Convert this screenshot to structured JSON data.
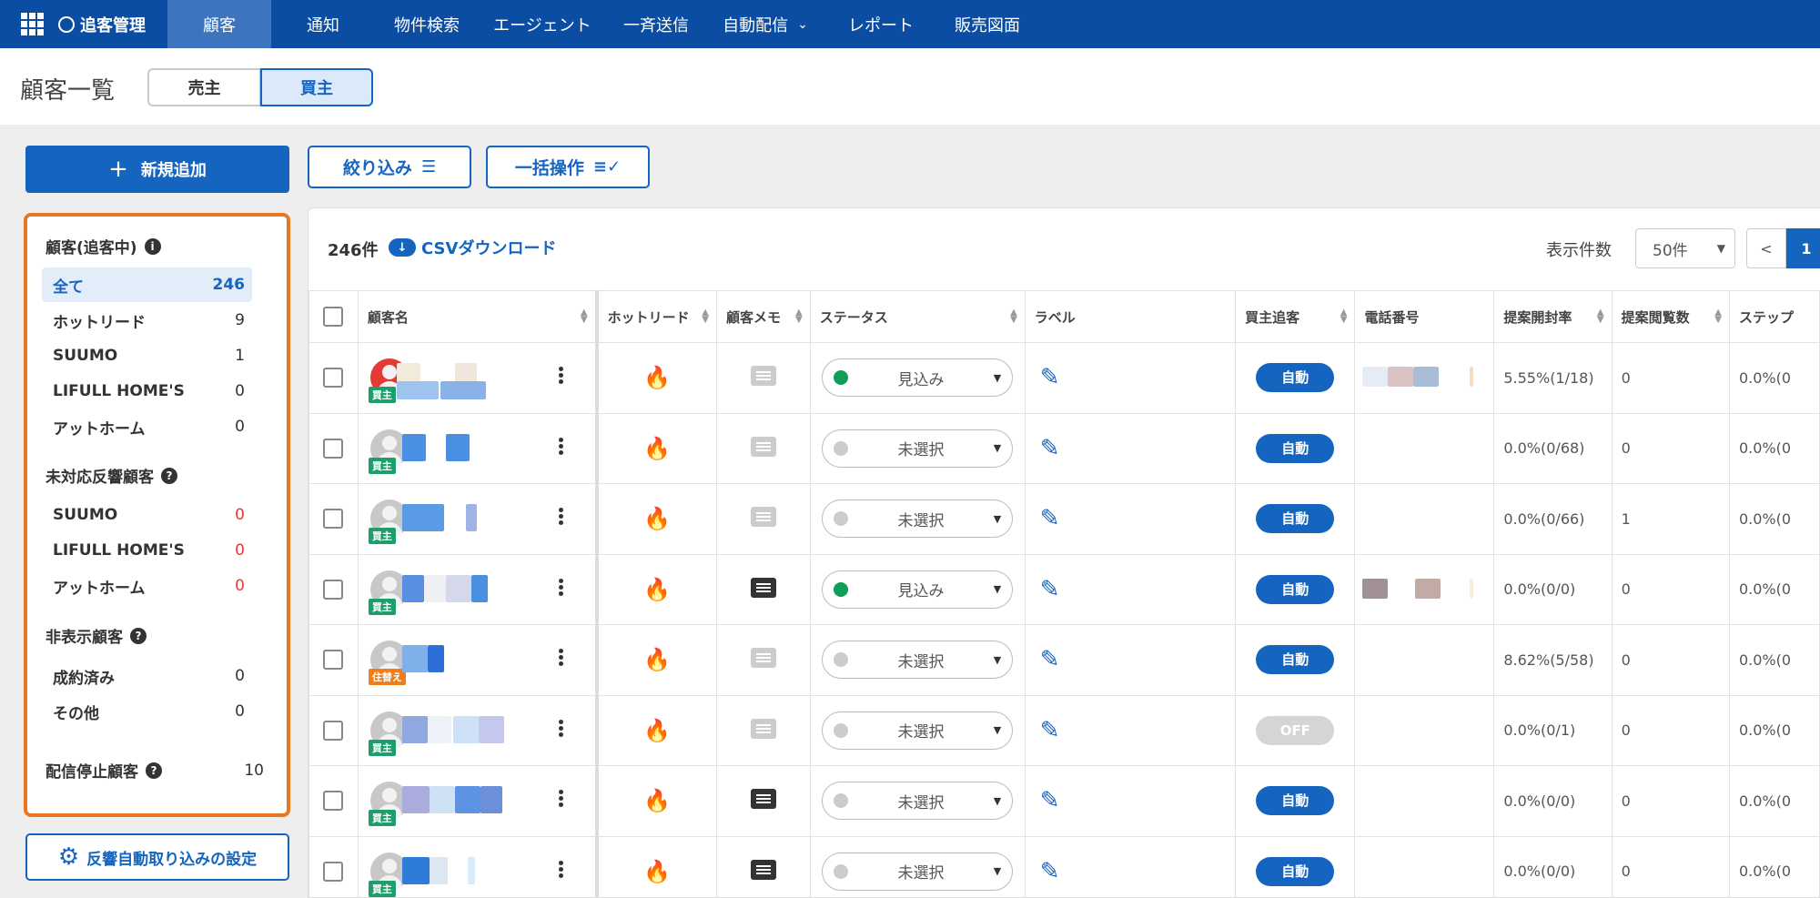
{
  "nav": {
    "brand": "追客管理",
    "items": [
      "顧客",
      "通知",
      "物件検索",
      "エージェント",
      "一斉送信",
      "自動配信",
      "レポート",
      "販売図面"
    ]
  },
  "header": {
    "title": "顧客一覧",
    "seg_sell": "売主",
    "seg_buy": "買主"
  },
  "sidebar": {
    "new_button": "新規追加",
    "section_tracking": "顧客(追客中)",
    "section_unhandled": "未対応反響顧客",
    "section_hidden": "非表示顧客",
    "section_stopped": "配信停止顧客",
    "stopped_count": "10",
    "items": [
      {
        "label": "全て",
        "count": "246"
      },
      {
        "label": "ホットリード",
        "count": "9"
      },
      {
        "label": "SUUMO",
        "count": "1"
      },
      {
        "label": "LIFULL HOME'S",
        "count": "0"
      },
      {
        "label": "アットホーム",
        "count": "0"
      },
      {
        "label": "SUUMO",
        "count": "0"
      },
      {
        "label": "LIFULL HOME'S",
        "count": "0"
      },
      {
        "label": "アットホーム",
        "count": "0"
      },
      {
        "label": "成約済み",
        "count": "0"
      },
      {
        "label": "その他",
        "count": "0"
      }
    ],
    "settings_button": "反響自動取り込みの設定"
  },
  "filters": {
    "filter_label": "絞り込み",
    "bulk_label": "一括操作"
  },
  "toolbar": {
    "count": "246件",
    "csv": "CSVダウンロード",
    "per_page_label": "表示件数",
    "per_page_value": "50件",
    "prev": "<",
    "page": "1"
  },
  "table": {
    "headers": [
      "顧客名",
      "ホットリード",
      "顧客メモ",
      "ステータス",
      "ラベル",
      "買主追客",
      "電話番号",
      "提案開封率",
      "提案閲覧数",
      "ステップ"
    ],
    "rows": [
      {
        "tag": "買主",
        "status": "見込み",
        "auto": "自動",
        "rate": "5.55%(1/18)",
        "views": "0",
        "step": "0.0%(0"
      },
      {
        "tag": "買主",
        "status": "未選択",
        "auto": "自動",
        "rate": "0.0%(0/68)",
        "views": "0",
        "step": "0.0%(0"
      },
      {
        "tag": "買主",
        "status": "未選択",
        "auto": "自動",
        "rate": "0.0%(0/66)",
        "views": "1",
        "step": "0.0%(0"
      },
      {
        "tag": "買主",
        "status": "見込み",
        "auto": "自動",
        "rate": "0.0%(0/0)",
        "views": "0",
        "step": "0.0%(0"
      },
      {
        "tag": "住替え",
        "status": "未選択",
        "auto": "自動",
        "rate": "8.62%(5/58)",
        "views": "0",
        "step": "0.0%(0"
      },
      {
        "tag": "買主",
        "status": "未選択",
        "auto": "OFF",
        "rate": "0.0%(0/1)",
        "views": "0",
        "step": "0.0%(0"
      },
      {
        "tag": "買主",
        "status": "未選択",
        "auto": "自動",
        "rate": "0.0%(0/0)",
        "views": "0",
        "step": "0.0%(0"
      },
      {
        "tag": "買主",
        "status": "未選択",
        "auto": "自動",
        "rate": "0.0%(0/0)",
        "views": "0",
        "step": "0.0%(0"
      }
    ]
  },
  "colors": {
    "nav_bg": "#0b4da2",
    "accent": "#1565c0",
    "highlight_border": "#e87722",
    "status_green": "#0f9d58",
    "alert_red": "#e53935"
  }
}
